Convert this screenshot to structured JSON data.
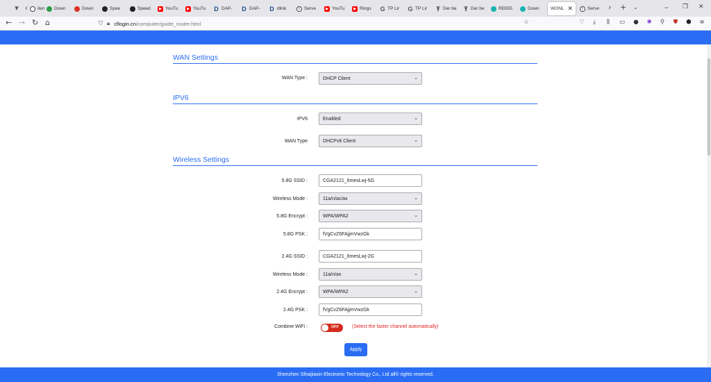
{
  "browser": {
    "tabs": [
      {
        "label": "iten",
        "favicon": "doc-icon"
      },
      {
        "label": "Down",
        "favicon": "shield-green-icon"
      },
      {
        "label": "Down",
        "favicon": "red-circle-icon"
      },
      {
        "label": "Spee",
        "favicon": "speedtest-icon"
      },
      {
        "label": "Speed",
        "favicon": "speedtest-icon"
      },
      {
        "label": "YouTu",
        "favicon": "youtube-icon"
      },
      {
        "label": "YouTu",
        "favicon": "youtube-icon"
      },
      {
        "label": "DAP-",
        "favicon": "dlink-icon"
      },
      {
        "label": "DAP-",
        "favicon": "dlink-icon"
      },
      {
        "label": "dlink",
        "favicon": "dlink-icon"
      },
      {
        "label": "Serve",
        "favicon": "info-icon"
      },
      {
        "label": "YouTu",
        "favicon": "youtube-icon"
      },
      {
        "label": "Rings",
        "favicon": "youtube-icon"
      },
      {
        "label": "TP Lir",
        "favicon": "google-icon"
      },
      {
        "label": "TP Lir",
        "favicon": "google-icon"
      },
      {
        "label": "Der be",
        "favicon": "der-icon"
      },
      {
        "label": "Der be",
        "favicon": "der-icon"
      },
      {
        "label": "RE655",
        "favicon": "tplink-icon"
      },
      {
        "label": "Down",
        "favicon": "tplink-icon"
      },
      {
        "label": "WONL",
        "favicon": "none",
        "active": true
      },
      {
        "label": "Serve",
        "favicon": "info-icon"
      }
    ],
    "url_host": "cflogin.cn",
    "url_path": "/computer/guide_router.html"
  },
  "sections": {
    "wan_title": "WAN Settings",
    "ipv6_title": "IPV6",
    "wireless_title": "Wireless Settings"
  },
  "wan": {
    "type_label": "WAN Type :",
    "type_value": "DHCP Client"
  },
  "ipv6": {
    "ipv6_label": "IPV6",
    "ipv6_value": "Enabled",
    "wan_type_label": "WAN Type",
    "wan_type_value": "DHCPv6 Client"
  },
  "wireless": {
    "ssid_5g_label": "5.8G SSID :",
    "ssid_5g_value": "CGA2121_6mesLwj-5G",
    "mode_5g_label": "Wireless Mode :",
    "mode_5g_value": "11a/n/ac/ax",
    "encrypt_5g_label": "5.8G Encrypt :",
    "encrypt_5g_value": "WPA/WPA2",
    "psk_5g_label": "5.8G PSK :",
    "psk_5g_value": "fVgCvZ6FAjjmVwzGk",
    "ssid_2g_label": "2.4G SSID :",
    "ssid_2g_value": "CGA2121_6mesLwj-2G",
    "mode_2g_label": "Wireless Mode :",
    "mode_2g_value": "11a/n/ax",
    "encrypt_2g_label": "2.4G Encrypt :",
    "encrypt_2g_value": "WPA/WPA2",
    "psk_2g_label": "2.4G PSK :",
    "psk_2g_value": "fVgCvZ6FAjjmVwzGk",
    "combine_label": "Combine WiFi :",
    "combine_state": "OFF",
    "combine_hint": "(Select the faster channel automatically)"
  },
  "apply_label": "Apply",
  "footer": "Shenzhen Sihaijiaxin Electronic Technology Co., Ltd all© rights reserved.",
  "colors": {
    "accent": "#2a6df4",
    "toggle_off": "#d52b1e",
    "hint_text": "#e02020"
  }
}
